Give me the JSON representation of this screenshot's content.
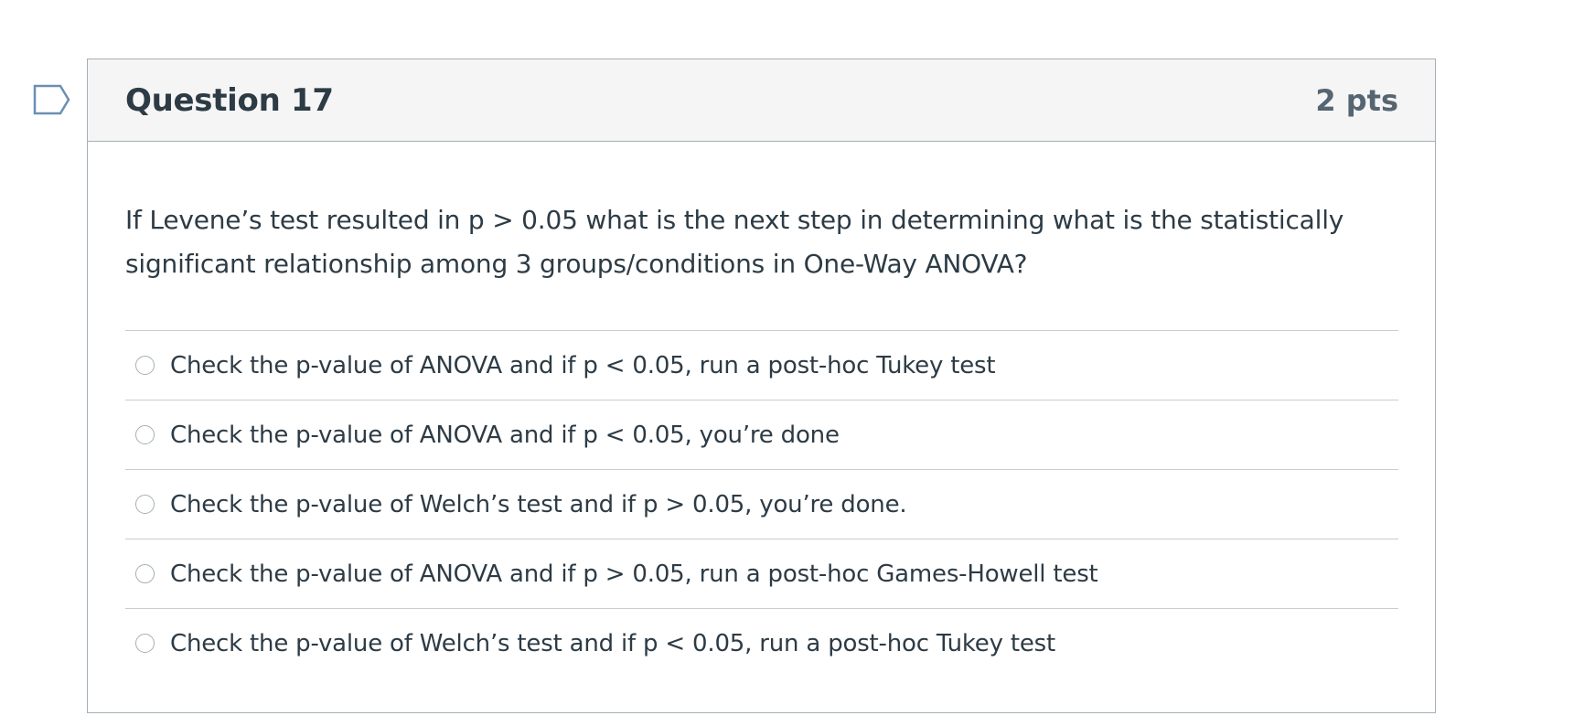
{
  "question": {
    "title": "Question 17",
    "points": "2 pts",
    "flag_icon": "flag-outline-icon",
    "text": "If Levene’s test resulted in p > 0.05 what is the next step in determining what is the statistically significant relationship among 3 groups/conditions in One-Way ANOVA?",
    "answers": [
      {
        "label": "Check the p-value of ANOVA and if p < 0.05, run a post-hoc Tukey test"
      },
      {
        "label": "Check the p-value of ANOVA and if p < 0.05, you’re done"
      },
      {
        "label": "Check the p-value of Welch’s test and if p > 0.05, you’re done."
      },
      {
        "label": "Check the p-value of ANOVA and if p > 0.05, run a post-hoc Games-Howell test"
      },
      {
        "label": "Check the p-value of Welch’s test and if p < 0.05, run a post-hoc Tukey test"
      }
    ]
  },
  "colors": {
    "text": "#2d3b45",
    "border": "#a5afb5",
    "header_bg": "#f5f5f5",
    "flag": "#6b8fb3"
  }
}
